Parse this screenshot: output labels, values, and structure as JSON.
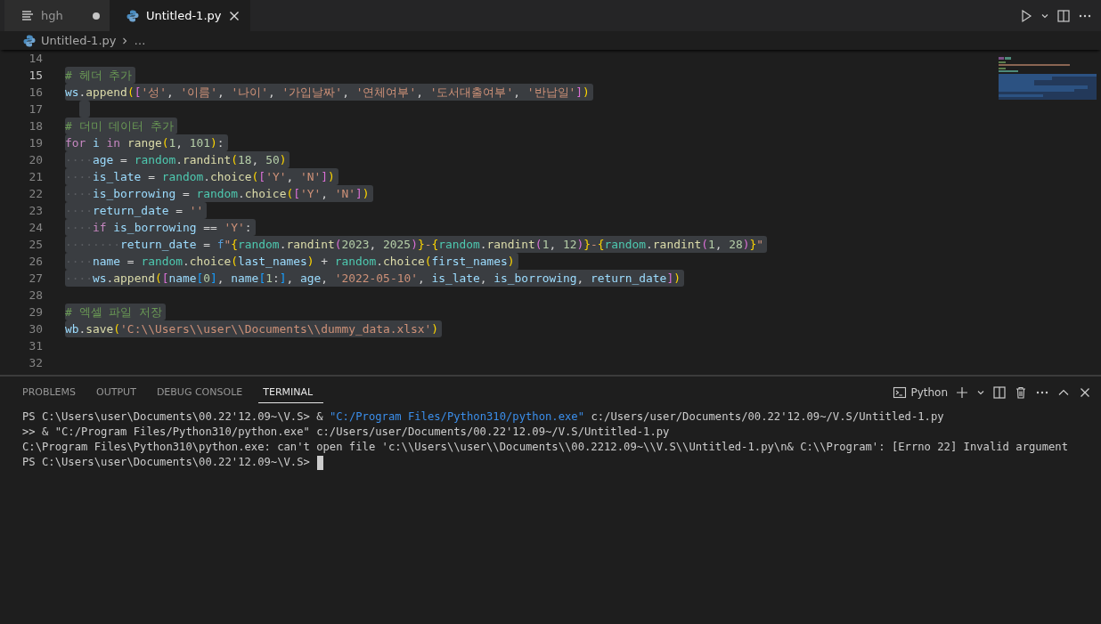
{
  "tabs": [
    {
      "label": "hgh",
      "kind": "text",
      "selected": false,
      "dirty": true
    },
    {
      "label": "Untitled-1.py",
      "kind": "python",
      "selected": true,
      "dirty": false
    }
  ],
  "breadcrumb": {
    "file": "Untitled-1.py",
    "more": "…"
  },
  "editor": {
    "lines": [
      {
        "number": "14",
        "selected": false,
        "current": false
      },
      {
        "number": "15",
        "selected": true,
        "current": true,
        "tokens": [
          {
            "kind": "comment",
            "text": "# 헤더 추가"
          }
        ]
      },
      {
        "number": "16",
        "selected": true,
        "current": false,
        "tokens": [
          {
            "kind": "var",
            "text": "ws"
          },
          {
            "kind": "plain",
            "text": "."
          },
          {
            "kind": "func",
            "text": "append"
          },
          {
            "kind": "b1",
            "text": "("
          },
          {
            "kind": "b2",
            "text": "["
          },
          {
            "kind": "string",
            "text": "'성'"
          },
          {
            "kind": "plain",
            "text": ", "
          },
          {
            "kind": "string",
            "text": "'이름'"
          },
          {
            "kind": "plain",
            "text": ", "
          },
          {
            "kind": "string",
            "text": "'나이'"
          },
          {
            "kind": "plain",
            "text": ", "
          },
          {
            "kind": "string",
            "text": "'가입날짜'"
          },
          {
            "kind": "plain",
            "text": ", "
          },
          {
            "kind": "string",
            "text": "'연체여부'"
          },
          {
            "kind": "plain",
            "text": ", "
          },
          {
            "kind": "string",
            "text": "'도서대출여부'"
          },
          {
            "kind": "plain",
            "text": ", "
          },
          {
            "kind": "string",
            "text": "'반납일'"
          },
          {
            "kind": "b2",
            "text": "]"
          },
          {
            "kind": "b1",
            "text": ")"
          }
        ]
      },
      {
        "number": "17",
        "selected": true,
        "current": false
      },
      {
        "number": "18",
        "selected": true,
        "current": false,
        "tokens": [
          {
            "kind": "comment",
            "text": "# 더미 데이터 추가"
          }
        ]
      },
      {
        "number": "19",
        "selected": true,
        "current": false,
        "tokens": [
          {
            "kind": "keyword",
            "text": "for "
          },
          {
            "kind": "var",
            "text": "i "
          },
          {
            "kind": "keyword",
            "text": "in "
          },
          {
            "kind": "func",
            "text": "range"
          },
          {
            "kind": "b1",
            "text": "("
          },
          {
            "kind": "number",
            "text": "1"
          },
          {
            "kind": "plain",
            "text": ", "
          },
          {
            "kind": "number",
            "text": "101"
          },
          {
            "kind": "b1",
            "text": ")"
          },
          {
            "kind": "plain",
            "text": ":"
          }
        ]
      },
      {
        "number": "20",
        "selected": true,
        "current": false,
        "tokens": [
          {
            "kind": "whitespace",
            "text": "····"
          },
          {
            "kind": "var",
            "text": "age"
          },
          {
            "kind": "plain",
            "text": " = "
          },
          {
            "kind": "module",
            "text": "random"
          },
          {
            "kind": "plain",
            "text": "."
          },
          {
            "kind": "func",
            "text": "randint"
          },
          {
            "kind": "b1",
            "text": "("
          },
          {
            "kind": "number",
            "text": "18"
          },
          {
            "kind": "plain",
            "text": ", "
          },
          {
            "kind": "number",
            "text": "50"
          },
          {
            "kind": "b1",
            "text": ")"
          }
        ]
      },
      {
        "number": "21",
        "selected": true,
        "current": false,
        "tokens": [
          {
            "kind": "whitespace",
            "text": "····"
          },
          {
            "kind": "var",
            "text": "is_late"
          },
          {
            "kind": "plain",
            "text": " = "
          },
          {
            "kind": "module",
            "text": "random"
          },
          {
            "kind": "plain",
            "text": "."
          },
          {
            "kind": "func",
            "text": "choice"
          },
          {
            "kind": "b1",
            "text": "("
          },
          {
            "kind": "b2",
            "text": "["
          },
          {
            "kind": "string",
            "text": "'Y'"
          },
          {
            "kind": "plain",
            "text": ", "
          },
          {
            "kind": "string",
            "text": "'N'"
          },
          {
            "kind": "b2",
            "text": "]"
          },
          {
            "kind": "b1",
            "text": ")"
          }
        ]
      },
      {
        "number": "22",
        "selected": true,
        "current": false,
        "tokens": [
          {
            "kind": "whitespace",
            "text": "····"
          },
          {
            "kind": "var",
            "text": "is_borrowing"
          },
          {
            "kind": "plain",
            "text": " = "
          },
          {
            "kind": "module",
            "text": "random"
          },
          {
            "kind": "plain",
            "text": "."
          },
          {
            "kind": "func",
            "text": "choice"
          },
          {
            "kind": "b1",
            "text": "("
          },
          {
            "kind": "b2",
            "text": "["
          },
          {
            "kind": "string",
            "text": "'Y'"
          },
          {
            "kind": "plain",
            "text": ", "
          },
          {
            "kind": "string",
            "text": "'N'"
          },
          {
            "kind": "b2",
            "text": "]"
          },
          {
            "kind": "b1",
            "text": ")"
          }
        ]
      },
      {
        "number": "23",
        "selected": true,
        "current": false,
        "tokens": [
          {
            "kind": "whitespace",
            "text": "····"
          },
          {
            "kind": "var",
            "text": "return_date"
          },
          {
            "kind": "plain",
            "text": " = "
          },
          {
            "kind": "string",
            "text": "''"
          }
        ]
      },
      {
        "number": "24",
        "selected": true,
        "current": false,
        "tokens": [
          {
            "kind": "whitespace",
            "text": "····"
          },
          {
            "kind": "keyword",
            "text": "if "
          },
          {
            "kind": "var",
            "text": "is_borrowing"
          },
          {
            "kind": "plain",
            "text": " == "
          },
          {
            "kind": "string",
            "text": "'Y'"
          },
          {
            "kind": "plain",
            "text": ":"
          }
        ]
      },
      {
        "number": "25",
        "selected": true,
        "current": false,
        "tokens": [
          {
            "kind": "whitespace",
            "text": "········"
          },
          {
            "kind": "var",
            "text": "return_date"
          },
          {
            "kind": "plain",
            "text": " = "
          },
          {
            "kind": "storage",
            "text": "f"
          },
          {
            "kind": "string",
            "text": "\""
          },
          {
            "kind": "b1",
            "text": "{"
          },
          {
            "kind": "module",
            "text": "random"
          },
          {
            "kind": "plain",
            "text": "."
          },
          {
            "kind": "func",
            "text": "randint"
          },
          {
            "kind": "b2",
            "text": "("
          },
          {
            "kind": "number",
            "text": "2023"
          },
          {
            "kind": "plain",
            "text": ", "
          },
          {
            "kind": "number",
            "text": "2025"
          },
          {
            "kind": "b2",
            "text": ")"
          },
          {
            "kind": "b1",
            "text": "}"
          },
          {
            "kind": "string",
            "text": "-"
          },
          {
            "kind": "b1",
            "text": "{"
          },
          {
            "kind": "module",
            "text": "random"
          },
          {
            "kind": "plain",
            "text": "."
          },
          {
            "kind": "func",
            "text": "randint"
          },
          {
            "kind": "b2",
            "text": "("
          },
          {
            "kind": "number",
            "text": "1"
          },
          {
            "kind": "plain",
            "text": ", "
          },
          {
            "kind": "number",
            "text": "12"
          },
          {
            "kind": "b2",
            "text": ")"
          },
          {
            "kind": "b1",
            "text": "}"
          },
          {
            "kind": "string",
            "text": "-"
          },
          {
            "kind": "b1",
            "text": "{"
          },
          {
            "kind": "module",
            "text": "random"
          },
          {
            "kind": "plain",
            "text": "."
          },
          {
            "kind": "func",
            "text": "randint"
          },
          {
            "kind": "b2",
            "text": "("
          },
          {
            "kind": "number",
            "text": "1"
          },
          {
            "kind": "plain",
            "text": ", "
          },
          {
            "kind": "number",
            "text": "28"
          },
          {
            "kind": "b2",
            "text": ")"
          },
          {
            "kind": "b1",
            "text": "}"
          },
          {
            "kind": "string",
            "text": "\""
          }
        ]
      },
      {
        "number": "26",
        "selected": true,
        "current": false,
        "tokens": [
          {
            "kind": "whitespace",
            "text": "····"
          },
          {
            "kind": "var",
            "text": "name"
          },
          {
            "kind": "plain",
            "text": " = "
          },
          {
            "kind": "module",
            "text": "random"
          },
          {
            "kind": "plain",
            "text": "."
          },
          {
            "kind": "func",
            "text": "choice"
          },
          {
            "kind": "b1",
            "text": "("
          },
          {
            "kind": "var",
            "text": "last_names"
          },
          {
            "kind": "b1",
            "text": ")"
          },
          {
            "kind": "plain",
            "text": " + "
          },
          {
            "kind": "module",
            "text": "random"
          },
          {
            "kind": "plain",
            "text": "."
          },
          {
            "kind": "func",
            "text": "choice"
          },
          {
            "kind": "b1",
            "text": "("
          },
          {
            "kind": "var",
            "text": "first_names"
          },
          {
            "kind": "b1",
            "text": ")"
          }
        ]
      },
      {
        "number": "27",
        "selected": true,
        "current": false,
        "tokens": [
          {
            "kind": "whitespace",
            "text": "····"
          },
          {
            "kind": "var",
            "text": "ws"
          },
          {
            "kind": "plain",
            "text": "."
          },
          {
            "kind": "func",
            "text": "append"
          },
          {
            "kind": "b1",
            "text": "("
          },
          {
            "kind": "b2",
            "text": "["
          },
          {
            "kind": "var",
            "text": "name"
          },
          {
            "kind": "b3",
            "text": "["
          },
          {
            "kind": "number",
            "text": "0"
          },
          {
            "kind": "b3",
            "text": "]"
          },
          {
            "kind": "plain",
            "text": ", "
          },
          {
            "kind": "var",
            "text": "name"
          },
          {
            "kind": "b3",
            "text": "["
          },
          {
            "kind": "number",
            "text": "1"
          },
          {
            "kind": "plain",
            "text": ":"
          },
          {
            "kind": "b3",
            "text": "]"
          },
          {
            "kind": "plain",
            "text": ", "
          },
          {
            "kind": "var",
            "text": "age"
          },
          {
            "kind": "plain",
            "text": ", "
          },
          {
            "kind": "string",
            "text": "'2022-05-10'"
          },
          {
            "kind": "plain",
            "text": ", "
          },
          {
            "kind": "var",
            "text": "is_late"
          },
          {
            "kind": "plain",
            "text": ", "
          },
          {
            "kind": "var",
            "text": "is_borrowing"
          },
          {
            "kind": "plain",
            "text": ", "
          },
          {
            "kind": "var",
            "text": "return_date"
          },
          {
            "kind": "b2",
            "text": "]"
          },
          {
            "kind": "b1",
            "text": ")"
          }
        ]
      },
      {
        "number": "28",
        "selected": false,
        "current": false
      },
      {
        "number": "29",
        "selected": true,
        "current": false,
        "tokens": [
          {
            "kind": "comment",
            "text": "# 엑셀 파일 저장"
          }
        ]
      },
      {
        "number": "30",
        "selected": true,
        "current": false,
        "tokens": [
          {
            "kind": "var",
            "text": "wb"
          },
          {
            "kind": "plain",
            "text": "."
          },
          {
            "kind": "func",
            "text": "save"
          },
          {
            "kind": "b1",
            "text": "("
          },
          {
            "kind": "string",
            "text": "'C:\\\\Users\\\\user\\\\Documents\\\\dummy_data.xlsx'"
          },
          {
            "kind": "b1",
            "text": ")"
          }
        ]
      },
      {
        "number": "31",
        "selected": false,
        "current": false
      },
      {
        "number": "32",
        "selected": false,
        "current": false
      }
    ]
  },
  "panel": {
    "tabs": [
      {
        "label": "PROBLEMS",
        "selected": false
      },
      {
        "label": "OUTPUT",
        "selected": false
      },
      {
        "label": "DEBUG CONSOLE",
        "selected": false
      },
      {
        "label": "TERMINAL",
        "selected": true
      }
    ],
    "shell": "Python",
    "terminal": [
      [
        {
          "kind": "plain",
          "text": "PS C:\\Users\\user\\Documents\\00.22'12.09~\\V.S> & "
        },
        {
          "kind": "link",
          "text": "\"C:/Program Files/Python310/python.exe\""
        },
        {
          "kind": "plain",
          "text": " c:/Users/user/Documents/00.22'12.09~/V.S/Untitled-1.py"
        }
      ],
      [
        {
          "kind": "plain",
          "text": ">> & \"C:/Program Files/Python310/python.exe\" c:/Users/user/Documents/00.22'12.09~/V.S/Untitled-1.py"
        }
      ],
      [
        {
          "kind": "plain",
          "text": "C:\\Program Files\\Python310\\python.exe: can't open file 'c:\\\\Users\\\\user\\\\Documents\\\\00.2212.09~\\\\V.S\\\\Untitled-1.py\\n& C:\\\\Program': [Errno 22] Invalid argument"
        }
      ],
      [
        {
          "kind": "plain",
          "text": "PS C:\\Users\\user\\Documents\\00.22'12.09~\\V.S>"
        },
        {
          "kind": "cursor"
        }
      ]
    ]
  }
}
